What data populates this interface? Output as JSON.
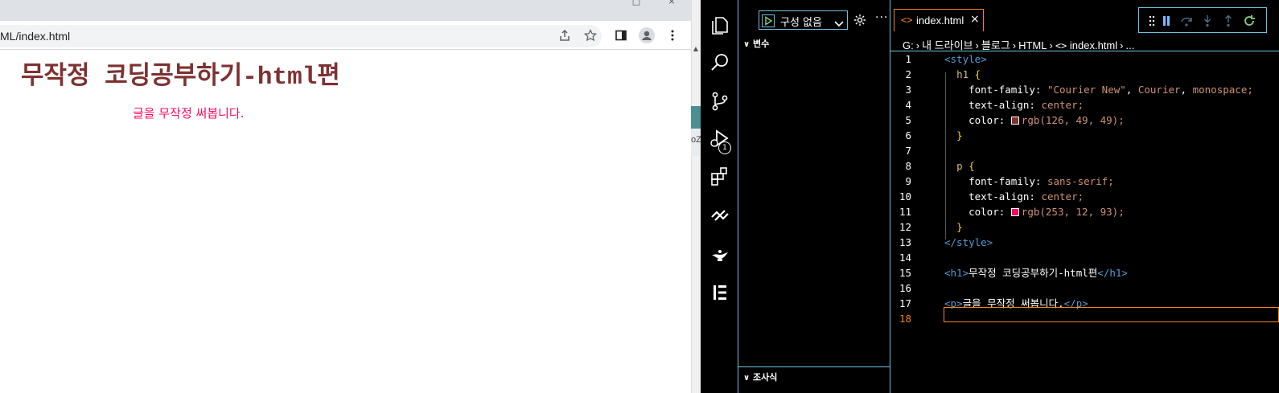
{
  "browser": {
    "address": "ML/index.html",
    "page": {
      "heading": "무작정 코딩공부하기-html편",
      "paragraph": "글을 무작정 써봅니다."
    },
    "side_strip_text": "oZ"
  },
  "vscode": {
    "debug": {
      "config_label": "구성 없음",
      "badge_count": "1"
    },
    "sidebar": {
      "variables_header": "변수",
      "watch_header": "조사식"
    },
    "tab": {
      "label": "index.html",
      "icon": "<>",
      "close": "×"
    },
    "breadcrumb": [
      "G:",
      "내 드라이브",
      "블로그",
      "HTML",
      "index.html",
      "..."
    ],
    "code_lines": [
      {
        "n": "1"
      },
      {
        "n": "2"
      },
      {
        "n": "3"
      },
      {
        "n": "4"
      },
      {
        "n": "5"
      },
      {
        "n": "6"
      },
      {
        "n": "7"
      },
      {
        "n": "8"
      },
      {
        "n": "9"
      },
      {
        "n": "10"
      },
      {
        "n": "11"
      },
      {
        "n": "12"
      },
      {
        "n": "13"
      },
      {
        "n": "14"
      },
      {
        "n": "15"
      },
      {
        "n": "16"
      },
      {
        "n": "17"
      },
      {
        "n": "18"
      }
    ],
    "code": {
      "l1": "<style>",
      "l2_sel": "h1",
      "l3_prop": "font-family:",
      "l3_v1": "\"Courier New\"",
      "l3_v2": "Courier",
      "l3_v3": "monospace;",
      "l4_prop": "text-align:",
      "l4_val": "center;",
      "l5_prop": "color:",
      "l5_val": "rgb(126, 49, 49);",
      "l5_swatch": "#7e3131",
      "l6": "}",
      "l8_sel": "p",
      "l9_prop": "font-family:",
      "l9_val": "sans-serif;",
      "l10_prop": "text-align:",
      "l10_val": "center;",
      "l11_prop": "color:",
      "l11_val": "rgb(253, 12, 93);",
      "l11_swatch": "#fd0c5d",
      "l12": "}",
      "l13": "</style>",
      "l15_open": "<h1>",
      "l15_text": "무작정 코딩공부하기-html편",
      "l15_close": "</h1>",
      "l17_open": "<p>",
      "l17_text": "글을 무작정 써봅니다.",
      "l17_close": "</p>"
    }
  },
  "colors": {
    "heading": "#7e3131",
    "paragraph": "#fd0c5d",
    "contrast_border": "#6fc3df",
    "active_orange": "#f38518"
  }
}
